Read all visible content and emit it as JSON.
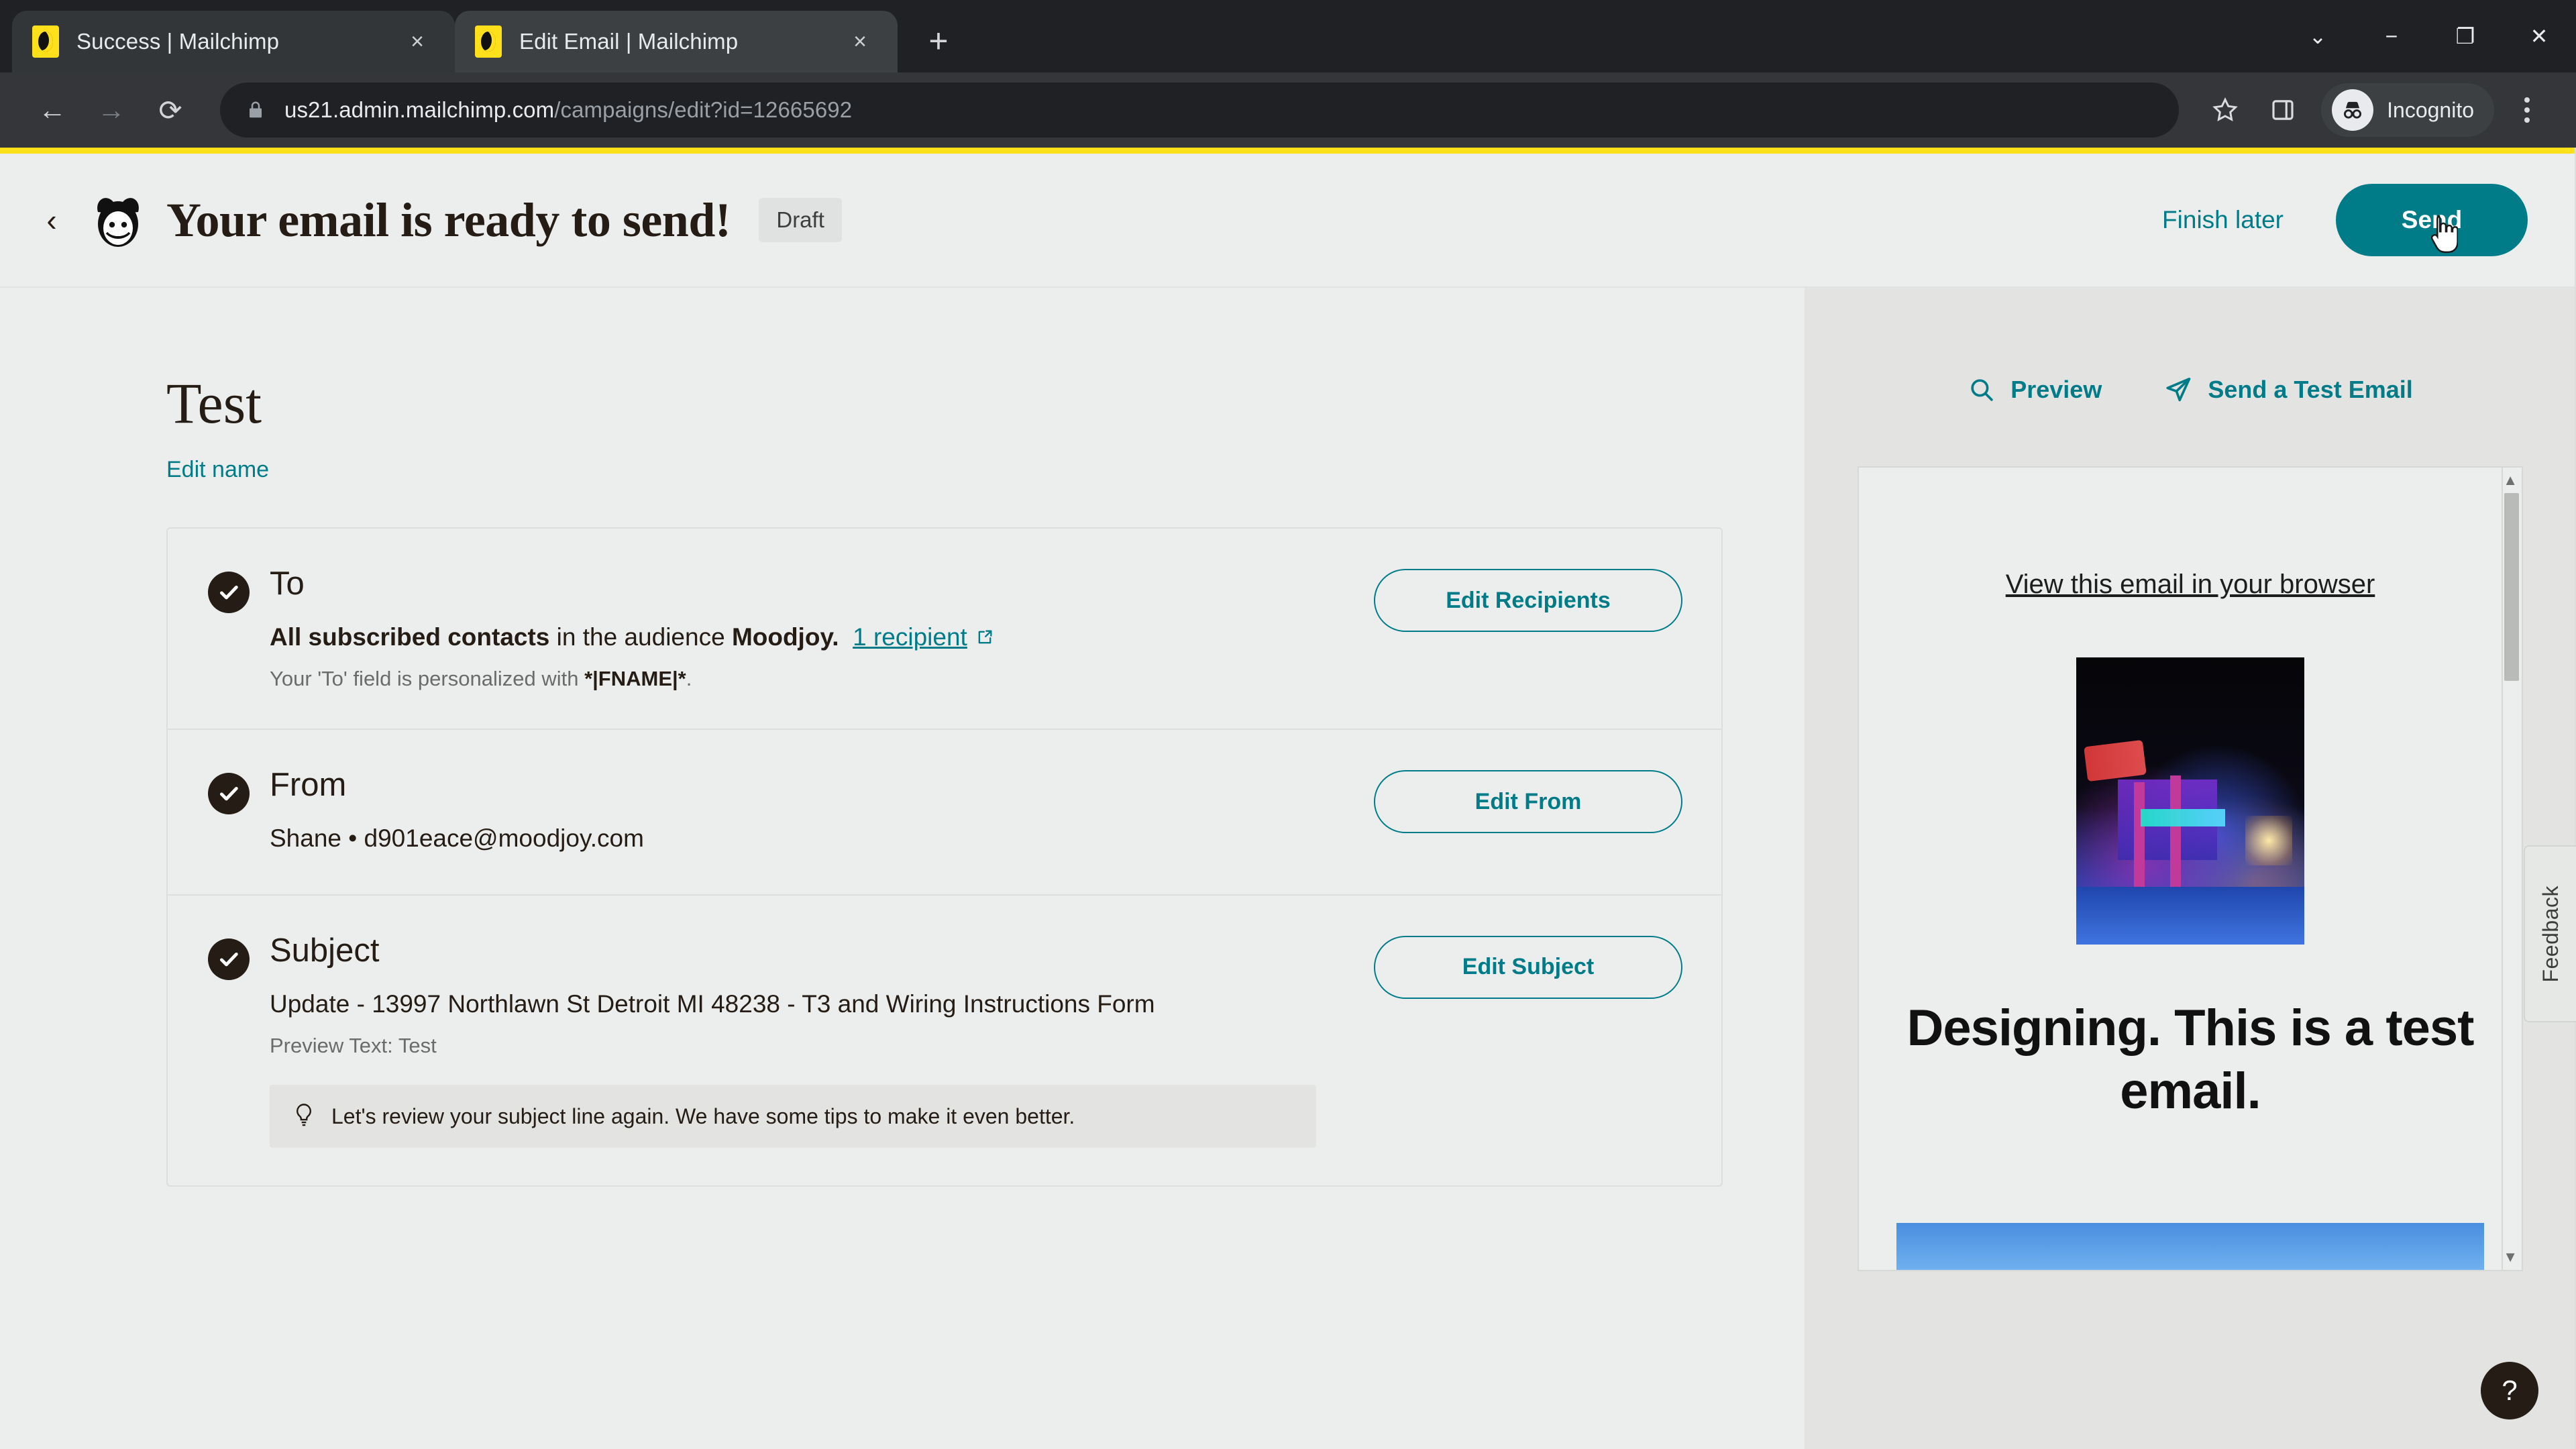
{
  "browser": {
    "tabs": [
      {
        "title": "Success | Mailchimp",
        "favicon": "mailchimp-favicon",
        "active": false,
        "close_label": "×"
      },
      {
        "title": "Edit Email | Mailchimp",
        "favicon": "mailchimp-favicon",
        "active": true,
        "close_label": "×"
      }
    ],
    "new_tab_label": "+",
    "window_controls": {
      "minimize_group": "⌄",
      "minimize": "−",
      "maximize": "❐",
      "close": "✕"
    },
    "nav": {
      "back": "←",
      "forward": "→",
      "reload": "⟳"
    },
    "omnibox": {
      "lock_icon": "lock-icon",
      "url_host": "us21.admin.mailchimp.com",
      "url_path": "/campaigns/edit?id=12665692",
      "full_url": "us21.admin.mailchimp.com/campaigns/edit?id=12665692"
    },
    "bookmark_icon": "star-icon",
    "sidepanel_icon": "side-panel-icon",
    "profile": {
      "label": "Incognito",
      "icon": "incognito-icon"
    },
    "menu_icon": "three-dot-menu-icon"
  },
  "app_header": {
    "back_icon": "chevron-left-icon",
    "logo": "mailchimp-logo",
    "title": "Your email is ready to send!",
    "status_badge": "Draft",
    "finish_later": "Finish later",
    "send_button": "Send",
    "cursor": "pointer-cursor"
  },
  "campaign": {
    "name": "Test",
    "edit_name_link": "Edit name"
  },
  "checklist": [
    {
      "id": "to",
      "title": "To",
      "checked_icon": "check-circle-icon",
      "detail_bold": "All subscribed contacts",
      "detail_mid": " in the audience ",
      "detail_audience": "Moodjoy.",
      "recipient_link": "1 recipient",
      "external_icon": "external-link-icon",
      "note_pre": "Your 'To' field is personalized with ",
      "note_token": "*|FNAME|*",
      "note_post": ".",
      "button": "Edit Recipients"
    },
    {
      "id": "from",
      "title": "From",
      "checked_icon": "check-circle-icon",
      "detail": "Shane  •  d901eace@moodjoy.com",
      "button": "Edit From"
    },
    {
      "id": "subject",
      "title": "Subject",
      "checked_icon": "check-circle-icon",
      "detail": "Update - 13997 Northlawn St Detroit MI 48238 - T3 and Wiring Instructions Form",
      "preview_text": "Preview Text: Test",
      "tip_icon": "lightbulb-icon",
      "tip": "Let's review your subject line again. We have some tips to make it even better.",
      "button": "Edit Subject"
    }
  ],
  "preview_panel": {
    "preview_action": "Preview",
    "preview_icon": "search-icon",
    "test_email_action": "Send a Test Email",
    "test_email_icon": "paper-plane-icon",
    "email": {
      "view_in_browser": "View this email in your browser",
      "hero_image_alt": "night-city-neon-photo",
      "headline": "Designing. This is a test email."
    },
    "scrollbar": {
      "up_arrow": "▲",
      "down_arrow": "▼"
    }
  },
  "feedback_tab": "Feedback",
  "help_button": "?",
  "colors": {
    "brand_teal": "#007c89",
    "brand_yellow": "#ffe01b",
    "ink": "#241c15",
    "page_bg": "#eceeed",
    "panel_bg": "#e3e4e2"
  }
}
